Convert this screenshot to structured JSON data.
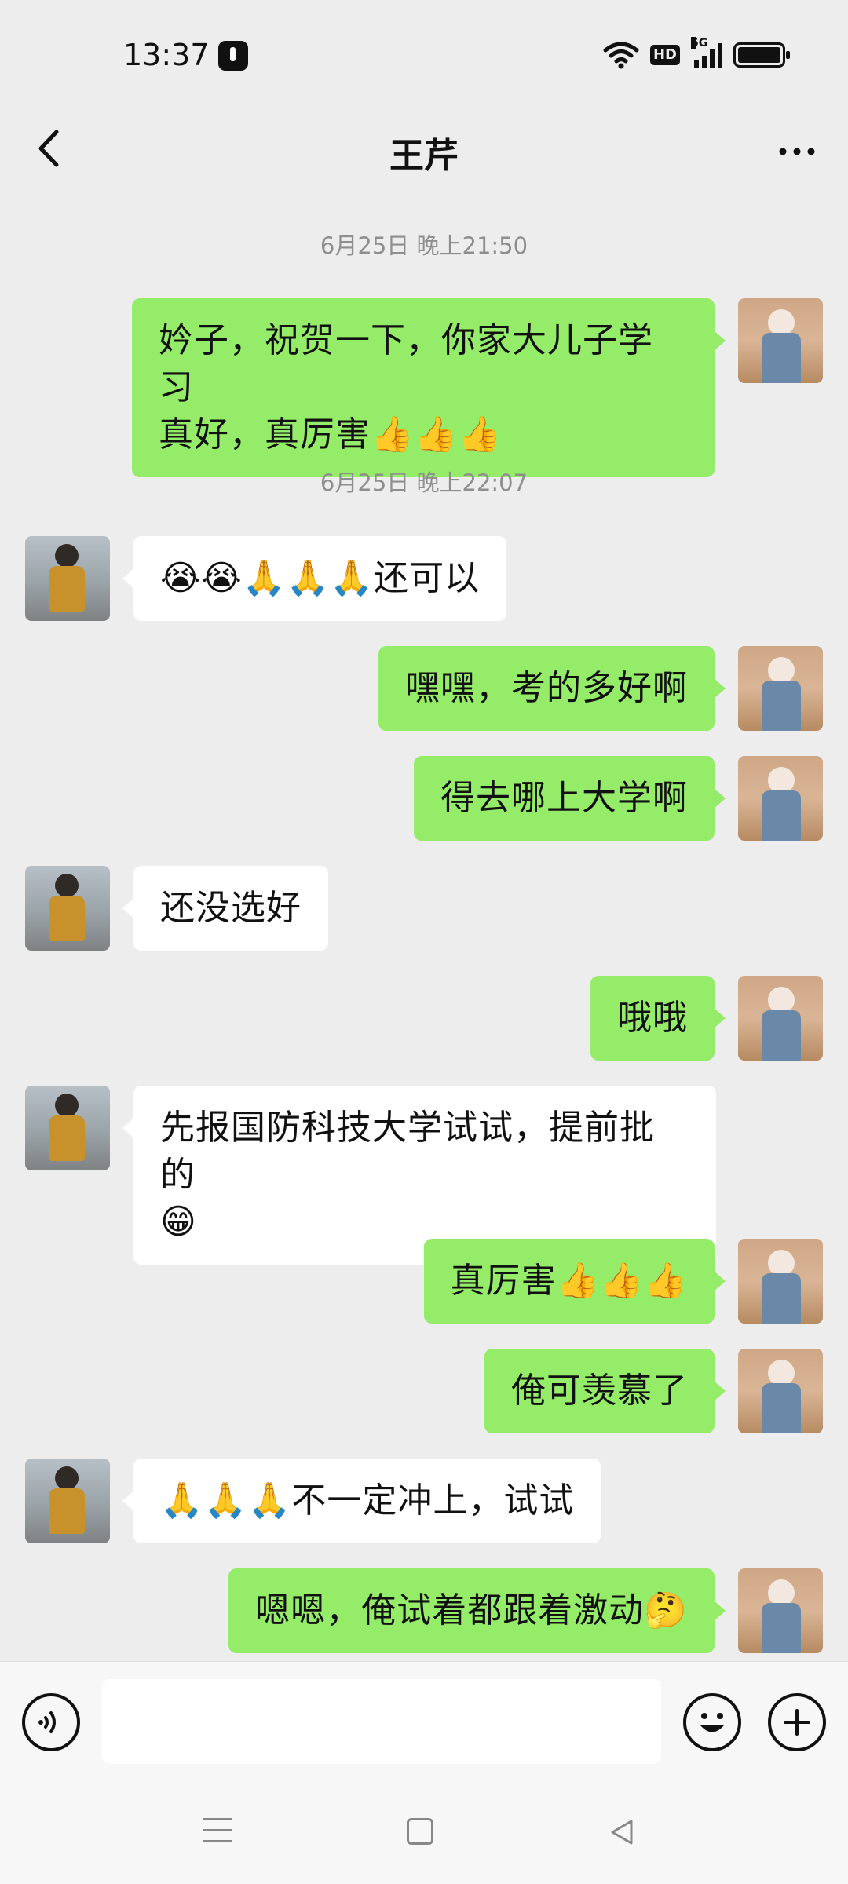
{
  "status_bar": {
    "time": "13:37",
    "notification_icon": "tiktok-icon",
    "network_badge": "HD",
    "network_type": "5G"
  },
  "header": {
    "title": "王芹",
    "back_icon": "chevron-left-icon",
    "more_icon": "more-dots-icon"
  },
  "messages": [
    {
      "type": "timestamp",
      "text": "6月25日 晚上21:50"
    },
    {
      "from": "me",
      "text": "妗子，祝贺一下，你家大儿子学习",
      "text2": "真好，真厉害👍👍👍"
    },
    {
      "type": "timestamp",
      "text": "6月25日 晚上22:07"
    },
    {
      "from": "them",
      "text": "😭😭🙏🙏🙏还可以"
    },
    {
      "from": "me",
      "text": "嘿嘿，考的多好啊"
    },
    {
      "from": "me",
      "text": "得去哪上大学啊"
    },
    {
      "from": "them",
      "text": "还没选好"
    },
    {
      "from": "me",
      "text": "哦哦"
    },
    {
      "from": "them",
      "text": "先报国防科技大学试试，提前批的",
      "text2": "😁"
    },
    {
      "from": "me",
      "text": "真厉害👍👍👍"
    },
    {
      "from": "me",
      "text": "俺可羡慕了"
    },
    {
      "from": "them",
      "text": "🙏🙏🙏不一定冲上，试试"
    },
    {
      "from": "me",
      "text": "嗯嗯，俺试着都跟着激动🤔"
    }
  ],
  "input_bar": {
    "voice_icon": "voice-icon",
    "input_value": "",
    "emoji_icon": "emoji-icon",
    "plus_icon": "plus-icon"
  },
  "colors": {
    "my_bubble": "#95EC69",
    "their_bubble": "#FFFFFF",
    "background": "#EDEDED",
    "timestamp_text": "#8E8E8E"
  }
}
